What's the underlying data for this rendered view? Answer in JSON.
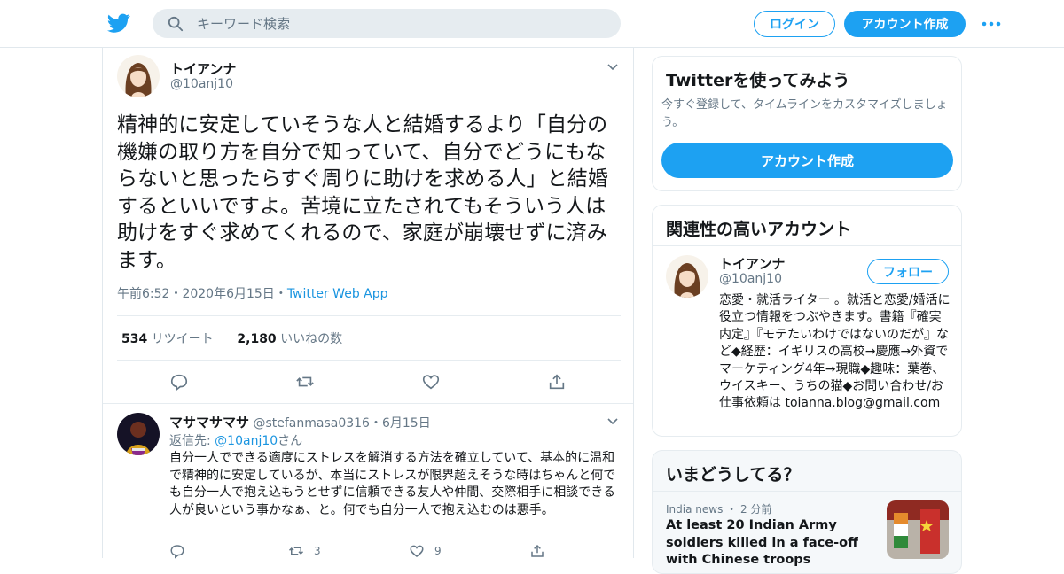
{
  "header": {
    "search_placeholder": "キーワード検索",
    "login_label": "ログイン",
    "signup_label": "アカウント作成"
  },
  "tweet": {
    "author_name": "トイアンナ",
    "author_handle": "@10anj10",
    "text": "精神的に安定していそうな人と結婚するより「自分の機嫌の取り方を自分で知っていて、自分でどうにもならないと思ったらすぐ周りに助けを求める人」と結婚するといいですよ。苦境に立たされてもそういう人は助けをすぐ求めてくれるので、家庭が崩壊せずに済みます。",
    "time": "午前6:52",
    "date": "2020年6月15日",
    "via": "Twitter Web App",
    "separator": "・",
    "retweet_count": "534",
    "retweet_label": "リツイート",
    "like_count": "2,180",
    "like_label": "いいねの数"
  },
  "reply": {
    "author_name": "マサマサマサ",
    "author_handle": "@stefanmasa0316",
    "date": "6月15日",
    "separator": "・",
    "reply_to_prefix": "返信先: ",
    "reply_to_handle": "@10anj10",
    "reply_to_suffix": "さん",
    "text": "自分一人でできる適度にストレスを解消する方法を確立していて、基本的に温和で精神的に安定しているが、本当にストレスが限界超えそうな時はちゃんと何でも自分一人で抱え込もうとせずに信頼できる友人や仲間、交際相手に相談できる人が良いという事かなぁ、と。何でも自分一人で抱え込むのは悪手。",
    "retweet_count": "3",
    "like_count": "9"
  },
  "sidebar": {
    "try_title": "Twitterを使ってみよう",
    "try_sub": "今すぐ登録して、タイムラインをカスタマイズしましょう。",
    "try_button": "アカウント作成",
    "related_title": "関連性の高いアカウント",
    "related_name": "トイアンナ",
    "related_handle": "@10anj10",
    "follow_label": "フォロー",
    "related_bio": "恋愛・就活ライター 。就活と恋愛/婚活に役立つ情報をつぶやきます。書籍『確実内定』『モテたいわけではないのだが』など◆経歴：イギリスの高校→慶應→外資でマーケティング4年→現職◆趣味：葉巻、ウイスキー、うちの猫◆お問い合わせ/お仕事依頼は toianna.blog@gmail.com",
    "trends_title": "いまどうしてる？",
    "trend_source": "India news ・ 2 分前",
    "trend_headline": "At least 20 Indian Army soldiers killed in a face-off with Chinese troops"
  },
  "colors": {
    "accent": "#1da1f2",
    "muted": "#657786",
    "border": "#e6ecf0"
  }
}
